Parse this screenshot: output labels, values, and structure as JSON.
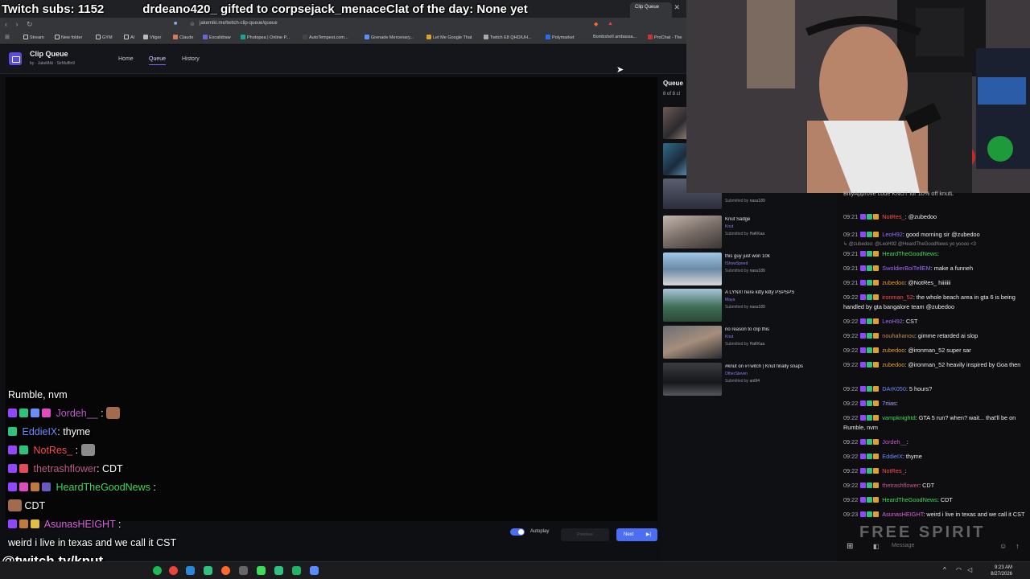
{
  "overlay": {
    "subs_text": "Twitch subs: 1152",
    "gift_text": "drdeano420_ gifted to corpsejack_menace",
    "clat_text": "Clat of the day: None yet"
  },
  "browser": {
    "tabs": [
      "Clip Queue"
    ],
    "url": "jakemiki.me/twitch-clip-queue/queue",
    "bookmarks": [
      "Stream",
      "New folder",
      "GYM",
      "AI",
      "Vtiger",
      "Claude",
      "Excalidraw",
      "Photopea | Online P...",
      "AutoTempest.com...",
      "Grenade Mercenary...",
      "Let Me Google That",
      "Twitch E8 QHD/UH...",
      "Polymarket",
      "Bombshell ambassa...",
      "ProChat - The"
    ]
  },
  "app": {
    "title": "Clip Queue",
    "subtitle": "by · JakeMiki · SirMuffin9",
    "nav": {
      "home": "Home",
      "queue": "Queue",
      "history": "History"
    },
    "queue_heading": "Queue",
    "queue_count": "8 of 8 cl",
    "autoplay_label": "Autoplay",
    "next_label": "Next",
    "previous_label": "Previous"
  },
  "queue_items": [
    {
      "title": "Knut Sadge",
      "channel": "Knut",
      "submitted_by": "HaKKaa"
    },
    {
      "title": "this guy just won 10k",
      "channel": "IShowSpeed",
      "submitted_by": "nasu189"
    },
    {
      "title": "A LYNX! here kitty kitty PSPSPS",
      "channel": "Maya",
      "submitted_by": "nasu189"
    },
    {
      "title": "no reason to clip this",
      "channel": "Knut",
      "submitted_by": "HaKKaa"
    },
    {
      "title": "#knut on #Twitch | Knut finally snaps",
      "channel": "OtherSteven",
      "submitted_by": "ant94"
    }
  ],
  "queue_partial_submitted": "nasu189",
  "submitted_prefix": "Submitted by",
  "overlay_chat": {
    "line1": "Rumble, nvm",
    "l2_user": "Jordeh__",
    "l3_user": "EddieIX",
    "l3_msg": ": thyme",
    "l4_user": "NotRes_",
    "l5_user": "thetrashflower",
    "l5_msg": ": CDT",
    "l6_user": "HeardTheGoodNews",
    "l7_msg": "CDT",
    "l8_user": "AsunasHEIGHT",
    "l9_msg": "weird i live in texas and we call it CST",
    "twitch_url": "@twitch.tv/knut"
  },
  "chat": {
    "promo": "BillyApprove code KNUT for 10% off knutL",
    "reply_line": "↳ @zubedoo: @LeoH92 @HeardTheGoodNews yo yoooo <3",
    "messages": [
      {
        "t": "09:21",
        "user": "NotRes_",
        "color": "#ff4d4d",
        "msg": ": @zubedoo"
      },
      {
        "t": "09:21",
        "user": "LeoH92",
        "color": "#9d6cff",
        "msg": ": good morning sir @zubedoo"
      },
      {
        "t": "09:21",
        "user": "HeardTheGoodNews",
        "color": "#3ddc5a",
        "msg": ":"
      },
      {
        "t": "09:21",
        "user": "SwoldierBoiTellEM",
        "color": "#9d6cff",
        "msg": ": make a funneh"
      },
      {
        "t": "09:21",
        "user": "zubedoo",
        "color": "#e0a030",
        "msg": ": @NotRes_ hiiiiiii"
      },
      {
        "t": "09:22",
        "user": "ironman_52",
        "color": "#ff4d4d",
        "msg": ": the whole beach area in gta 6 is being handled by gta bangalore team @zubedoo"
      },
      {
        "t": "09:22",
        "user": "LeoH92",
        "color": "#9d6cff",
        "msg": ": CST"
      },
      {
        "t": "09:22",
        "user": "nouhahanou",
        "color": "#c58a4a",
        "msg": ": gimme retarded ai slop"
      },
      {
        "t": "09:22",
        "user": "zubedoo",
        "color": "#e0a030",
        "msg": ": @ironman_52 super sar"
      },
      {
        "t": "09:22",
        "user": "zubedoo",
        "color": "#e0a030",
        "msg": ": @ironman_52 heavily inspired by Goa then"
      },
      {
        "t": "09:22",
        "user": "DArK050",
        "color": "#6a8cff",
        "msg": ": 5 hours?"
      },
      {
        "t": "09:22",
        "user": "7riias",
        "color": "#b09cff",
        "msg": ":"
      },
      {
        "t": "09:22",
        "user": "vampknightd",
        "color": "#3ddc5a",
        "msg": ": GTA 5 run? when? wait... that'll be on Rumble, nvm"
      },
      {
        "t": "09:22",
        "user": "Jordeh__",
        "color": "#c05ad0",
        "msg": ":"
      },
      {
        "t": "09:22",
        "user": "EddieIX",
        "color": "#6a8cff",
        "msg": ": thyme"
      },
      {
        "t": "09:22",
        "user": "NotRes_",
        "color": "#ff4d4d",
        "msg": ":"
      },
      {
        "t": "09:22",
        "user": "thetrashflower",
        "color": "#c05a8a",
        "msg": ": CDT"
      },
      {
        "t": "09:22",
        "user": "HeardTheGoodNews",
        "color": "#3ddc5a",
        "msg": ": CDT"
      },
      {
        "t": "09:23",
        "user": "AsunasHEIGHT",
        "color": "#e060e0",
        "msg": ": weird i live in texas and we call it CST"
      }
    ],
    "input_placeholder": "Message",
    "watermark": "FREE SPIRIT"
  },
  "taskbar": {
    "time": "9:23 AM",
    "date": "8/27/2026"
  },
  "colors": {
    "accent": "#4c6ef5",
    "brand": "#5b4ce0"
  }
}
